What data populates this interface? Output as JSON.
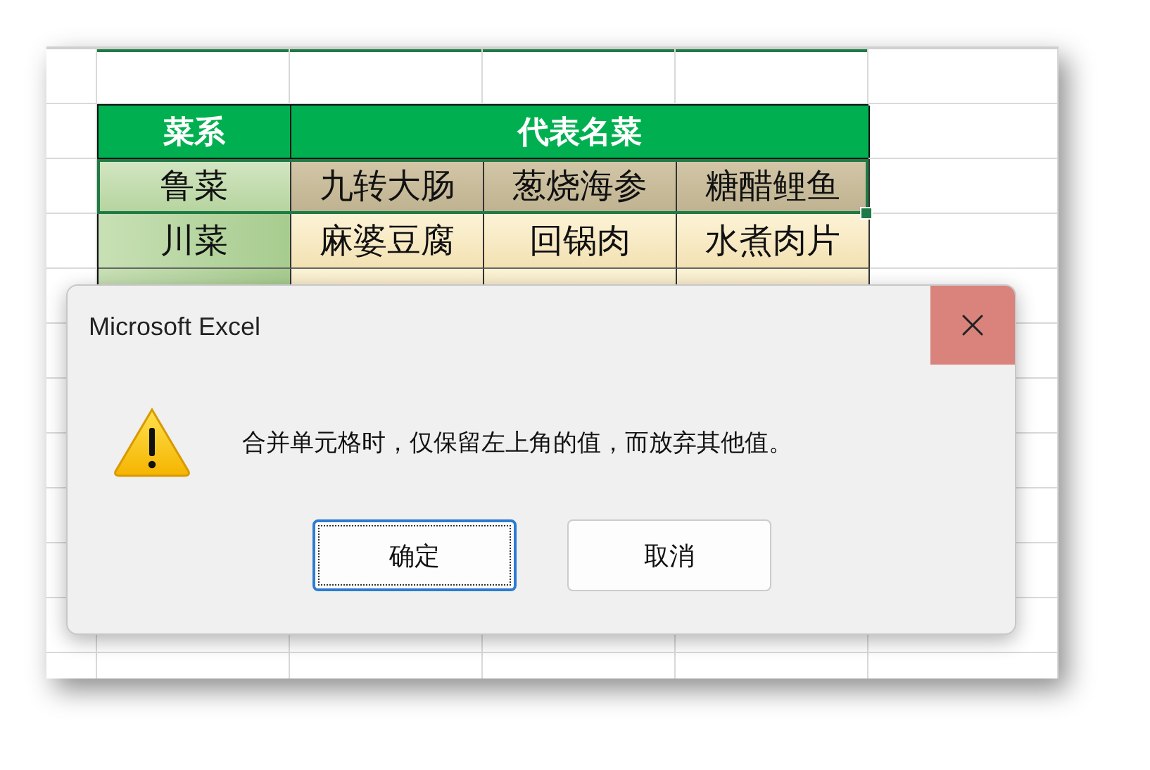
{
  "sheet": {
    "header": [
      "菜系",
      "代表名菜"
    ],
    "rows": [
      {
        "cuisine": "鲁菜",
        "dishes": [
          "九转大肠",
          "葱烧海参",
          "糖醋鲤鱼"
        ],
        "selected": true
      },
      {
        "cuisine": "川菜",
        "dishes": [
          "麻婆豆腐",
          "回锅肉",
          "水煮肉片"
        ],
        "selected": false
      }
    ]
  },
  "dialog": {
    "title": "Microsoft Excel",
    "message": "合并单元格时，仅保留左上角的值，而放弃其他值。",
    "buttons": [
      {
        "label": "确定",
        "focused": true
      },
      {
        "label": "取消",
        "focused": false
      }
    ]
  }
}
